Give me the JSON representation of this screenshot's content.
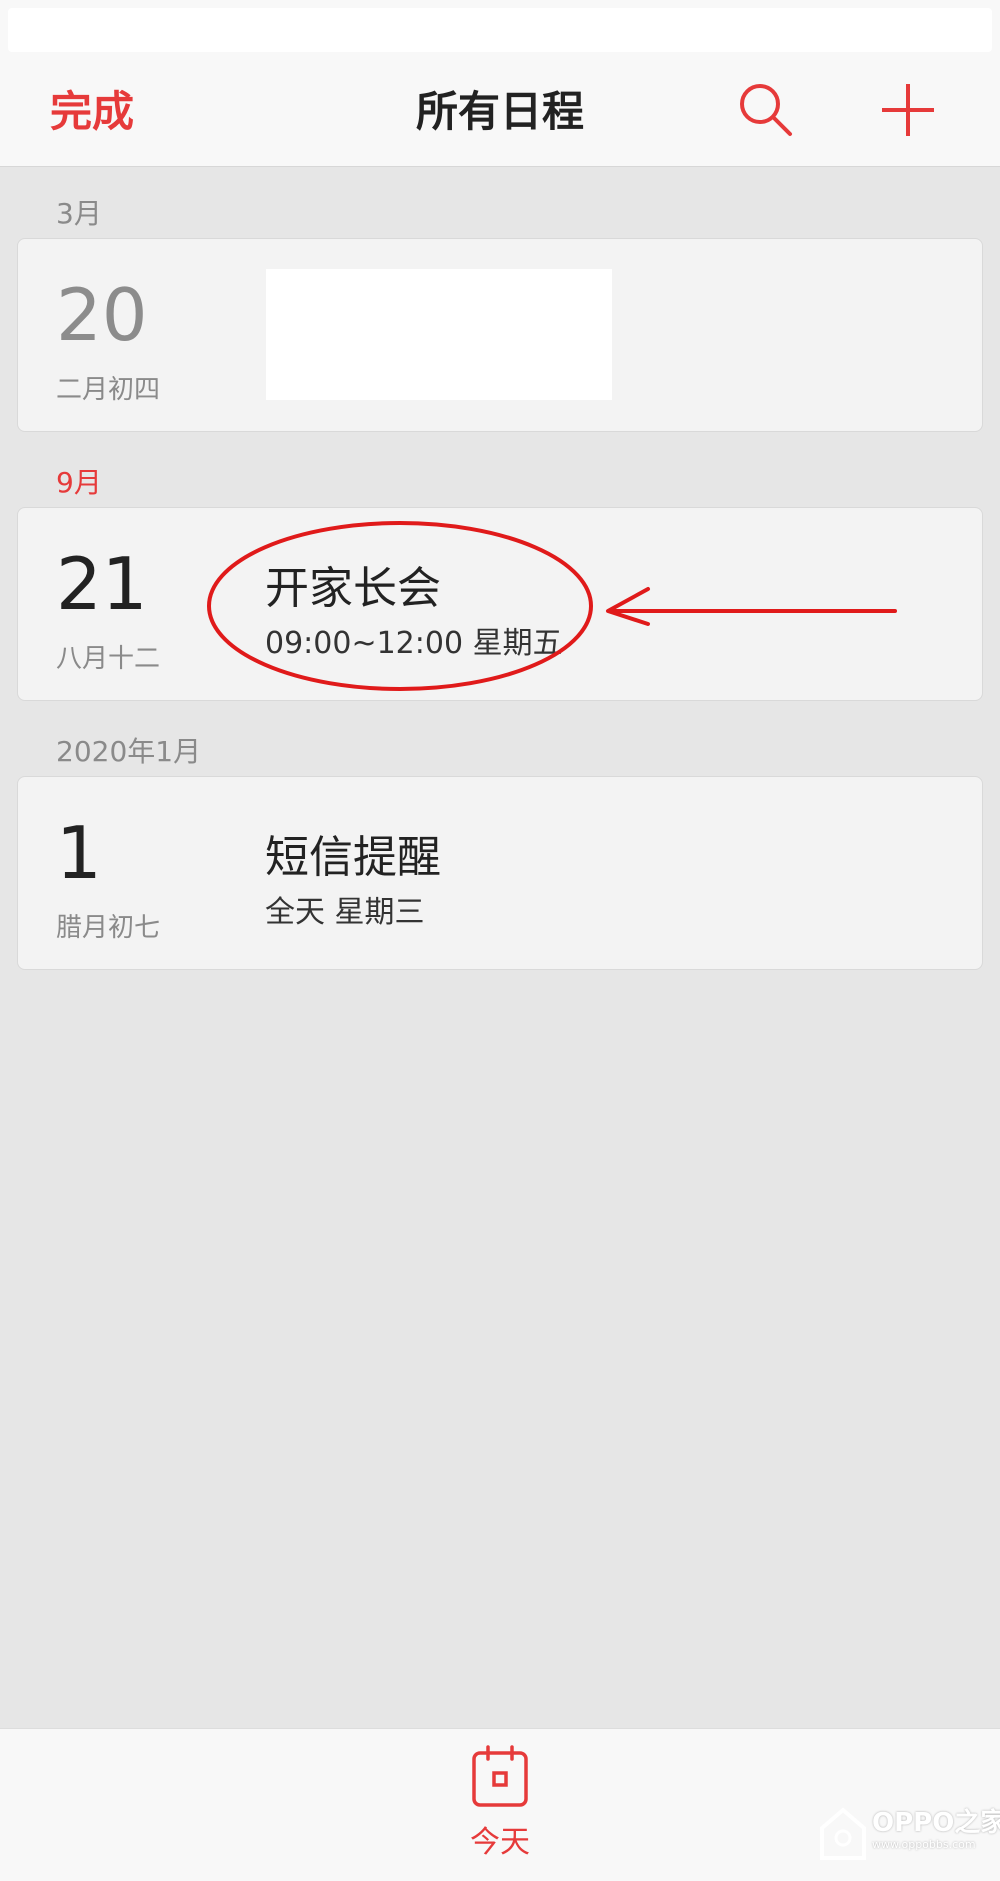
{
  "header": {
    "done_label": "完成",
    "title": "所有日程",
    "search_icon": "search-icon",
    "add_icon": "plus-icon"
  },
  "sections": [
    {
      "label": "3月",
      "events": [
        {
          "day": "20",
          "lunar": "二月初四",
          "title": "",
          "subtitle": "",
          "redacted": true
        }
      ]
    },
    {
      "label": "9月",
      "events": [
        {
          "day": "21",
          "lunar": "八月十二",
          "title": "开家长会",
          "subtitle": "09:00~12:00 星期五"
        }
      ]
    },
    {
      "label": "2020年1月",
      "events": [
        {
          "day": "1",
          "lunar": "腊月初七",
          "title": "短信提醒",
          "subtitle": "全天 星期三"
        }
      ]
    }
  ],
  "bottom": {
    "today_label": "今天",
    "today_icon": "calendar-today-icon"
  },
  "watermark": {
    "text": "OPPO之家",
    "sub": "www.oppobbs.com"
  },
  "colors": {
    "accent": "#e63a3a",
    "background": "#e6e6e6",
    "card": "#f3f3f3"
  }
}
